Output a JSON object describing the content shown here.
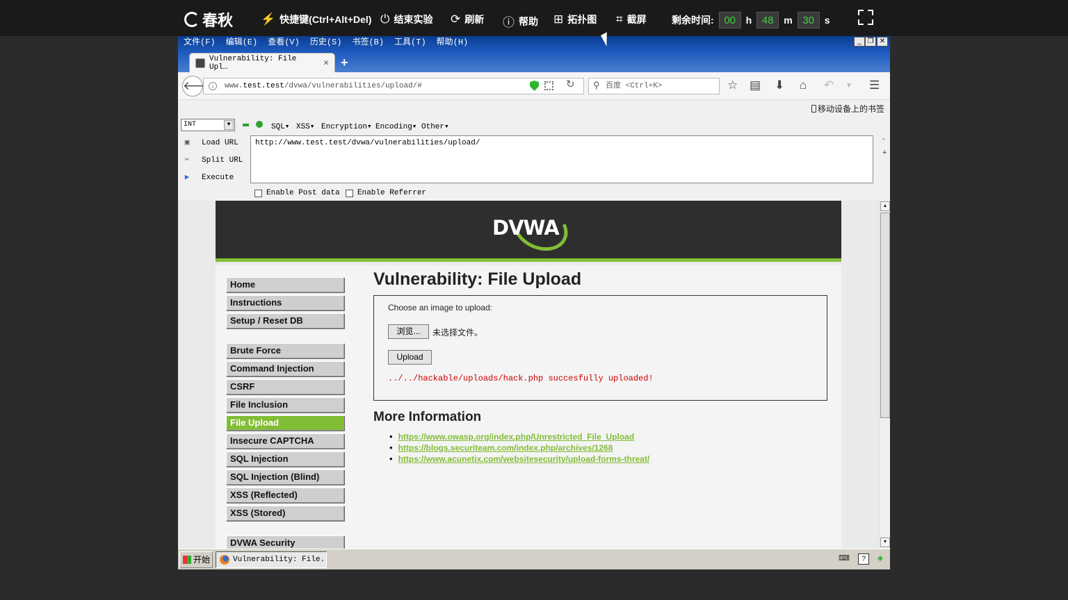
{
  "topbar": {
    "brand": "春秋",
    "shortcut": "快捷键(Ctrl+Alt+Del)",
    "end_experiment": "结束实验",
    "refresh": "刷新",
    "help": "帮助",
    "topology": "拓扑图",
    "screenshot": "截屏",
    "time_label": "剩余时间:",
    "time_h": "00",
    "h_unit": "h",
    "time_m": "48",
    "m_unit": "m",
    "time_s": "30",
    "s_unit": "s"
  },
  "browser": {
    "menu": [
      "文件(F)",
      "编辑(E)",
      "查看(V)",
      "历史(S)",
      "书签(B)",
      "工具(T)",
      "帮助(H)"
    ],
    "tab_title": "Vulnerability: File Upl…",
    "url_host": "www.test.test",
    "url_path": "/dvwa/vulnerabilities/upload/#",
    "url_prefix": "www.",
    "url_host_main": "test.test",
    "search_placeholder": "百度 <Ctrl+K>",
    "mobile_bookmarks": "移动设备上的书签"
  },
  "hackbar": {
    "select_value": "INT",
    "menus": [
      "SQL▾",
      "XSS▾",
      "Encryption▾",
      "Encoding▾",
      "Other▾"
    ],
    "load_url": "Load URL",
    "split_url": "Split URL",
    "execute": "Execute",
    "url_value": "http://www.test.test/dvwa/vulnerabilities/upload/",
    "enable_post": "Enable Post data",
    "enable_referrer": "Enable Referrer"
  },
  "dvwa": {
    "logo": "DVWA",
    "menu_group1": [
      "Home",
      "Instructions",
      "Setup / Reset DB"
    ],
    "menu_group2": [
      "Brute Force",
      "Command Injection",
      "CSRF",
      "File Inclusion",
      "File Upload",
      "Insecure CAPTCHA",
      "SQL Injection",
      "SQL Injection (Blind)",
      "XSS (Reflected)",
      "XSS (Stored)"
    ],
    "menu_group3": [
      "DVWA Security"
    ],
    "active_item": "File Upload",
    "title": "Vulnerability: File Upload",
    "upload_prompt": "Choose an image to upload:",
    "browse_label": "浏览...",
    "no_file": "未选择文件。",
    "upload_label": "Upload",
    "result_message": "../../hackable/uploads/hack.php succesfully uploaded!",
    "more_info_title": "More Information",
    "links": [
      "https://www.owasp.org/index.php/Unrestricted_File_Upload",
      "https://blogs.securiteam.com/index.php/archives/1268",
      "https://www.acunetix.com/websitesecurity/upload-forms-threat/"
    ]
  },
  "taskbar": {
    "start": "开始",
    "task_title": "Vulnerability: File..."
  },
  "colors": {
    "accent": "#82bd36",
    "timer": "#3fd13f",
    "error": "#cc0000"
  }
}
